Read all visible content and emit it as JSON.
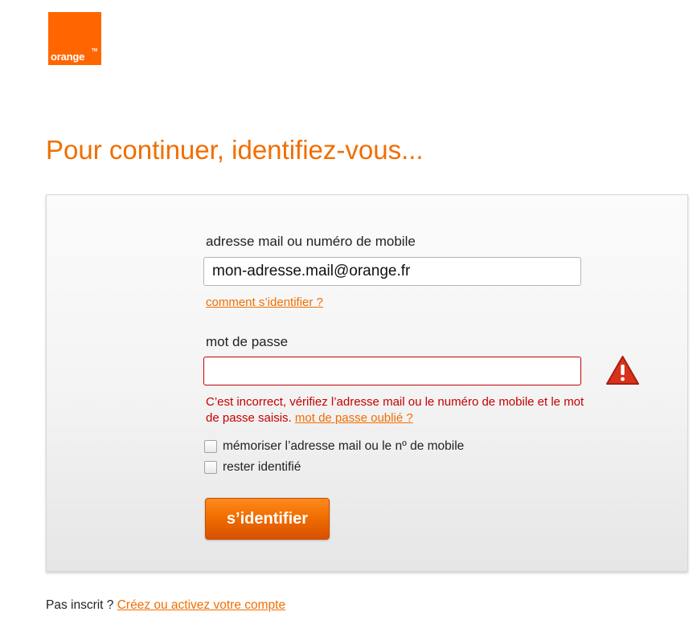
{
  "brand": {
    "logo_text": "orange",
    "logo_tm": "TM",
    "color": "#ff6600"
  },
  "title": "Pour continuer, identifiez-vous...",
  "login": {
    "id_label": "adresse mail ou numéro de mobile",
    "id_value": "mon-adresse.mail@orange.fr",
    "help_link": "comment s’identifier ?",
    "password_label": "mot de passe",
    "password_value": "",
    "error_text": "C’est incorrect, vérifiez l’adresse mail ou le numéro de mobile et le mot de passe saisis.",
    "forgot_link": "mot de passe oublié ?",
    "warning_icon": "warning-triangle-icon",
    "remember_label": "mémoriser l’adresse mail ou le nº de mobile",
    "remember_checked": false,
    "stay_label": "rester identifié",
    "stay_checked": false,
    "submit_label": "s’identifier"
  },
  "footer": {
    "prompt": "Pas inscrit ?",
    "link": "Créez ou activez votre compte"
  },
  "colors": {
    "accent": "#f16e00",
    "error": "#c60000"
  }
}
